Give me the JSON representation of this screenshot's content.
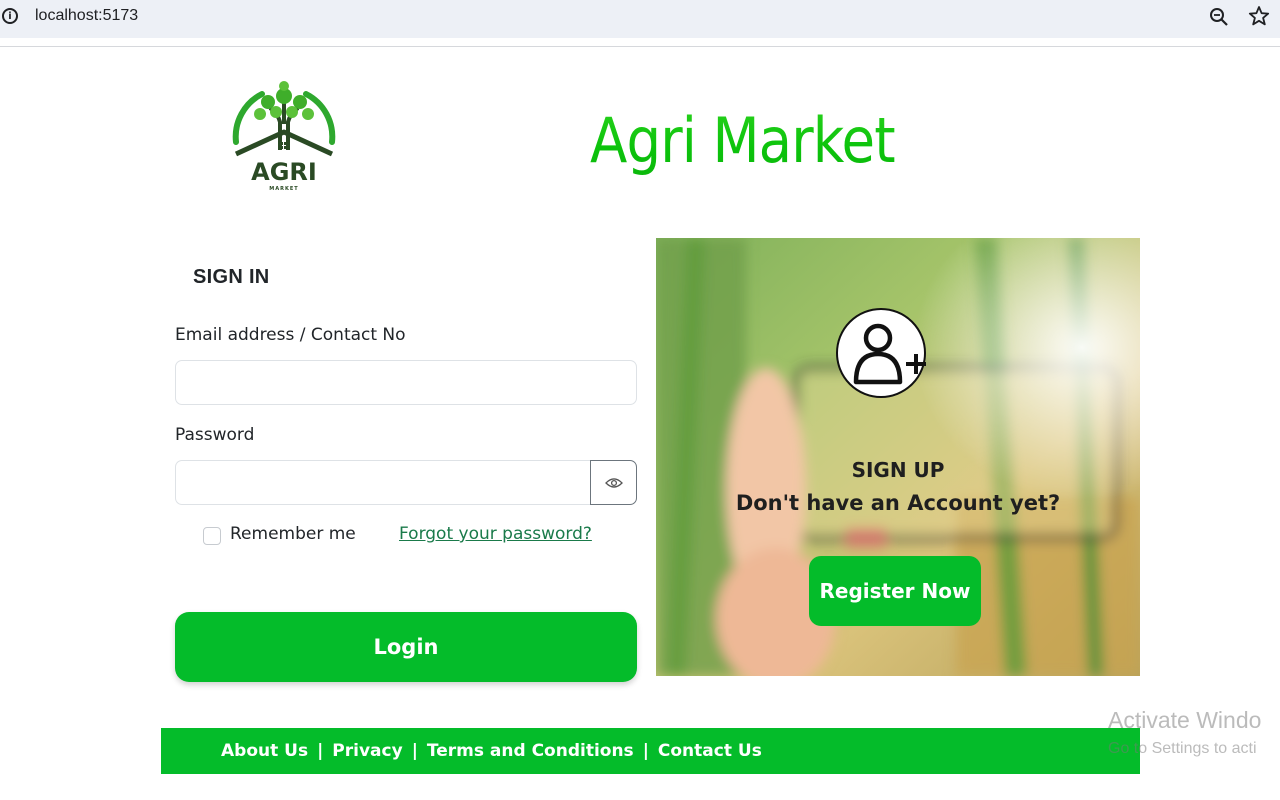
{
  "browser": {
    "url": "localhost:5173",
    "icons": [
      "info-icon",
      "zoom-icon",
      "star-icon"
    ]
  },
  "header": {
    "logo_text": "AGRI",
    "logo_subtext": "MARKET",
    "brand_title": "Agri Market"
  },
  "signin": {
    "heading": "SIGN IN",
    "email_label": "Email address / Contact No",
    "email_value": "",
    "password_label": "Password",
    "password_value": "",
    "remember_label": "Remember me",
    "remember_checked": false,
    "forgot_link": "Forgot your password?",
    "login_label": "Login"
  },
  "signup": {
    "icon": "user-add-icon",
    "title": "SIGN UP",
    "subtitle": "Don't have an Account yet?",
    "register_label": "Register Now"
  },
  "footer": {
    "links": [
      "About Us",
      "Privacy",
      "Terms and Conditions",
      "Contact Us"
    ],
    "separator": "|"
  },
  "watermark": {
    "title": "Activate Windo",
    "subtitle": "Go to Settings to acti"
  },
  "colors": {
    "primary_green": "#04bc2a",
    "brand_green": "#18c40f",
    "link_green": "#1a7a4a",
    "text_dark": "#212529"
  }
}
